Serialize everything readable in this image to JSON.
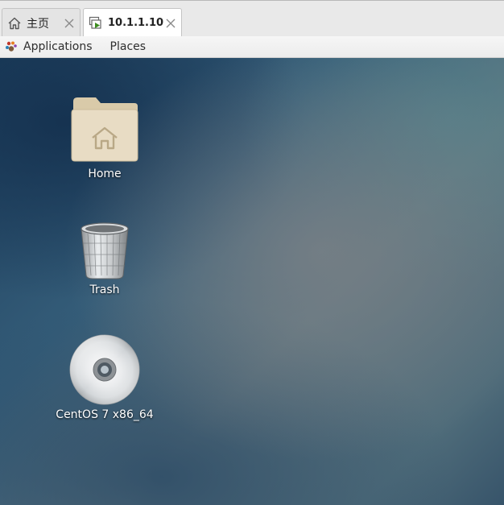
{
  "tabs": [
    {
      "label": "主页",
      "icon": "home-icon",
      "active": false
    },
    {
      "label": "10.1.1.10",
      "icon": "vm-console-icon",
      "active": true
    }
  ],
  "panel": {
    "applications_label": "Applications",
    "places_label": "Places"
  },
  "desktop": {
    "icons": [
      {
        "label": "Home",
        "icon": "home-folder-icon"
      },
      {
        "label": "Trash",
        "icon": "trash-icon"
      },
      {
        "label": "CentOS 7 x86_64",
        "icon": "optical-disc-icon"
      }
    ]
  },
  "colors": {
    "tab_bar": "#e9e9e9",
    "vm_play_accent": "#3c8c1e",
    "folder": "#e8dcc4"
  }
}
